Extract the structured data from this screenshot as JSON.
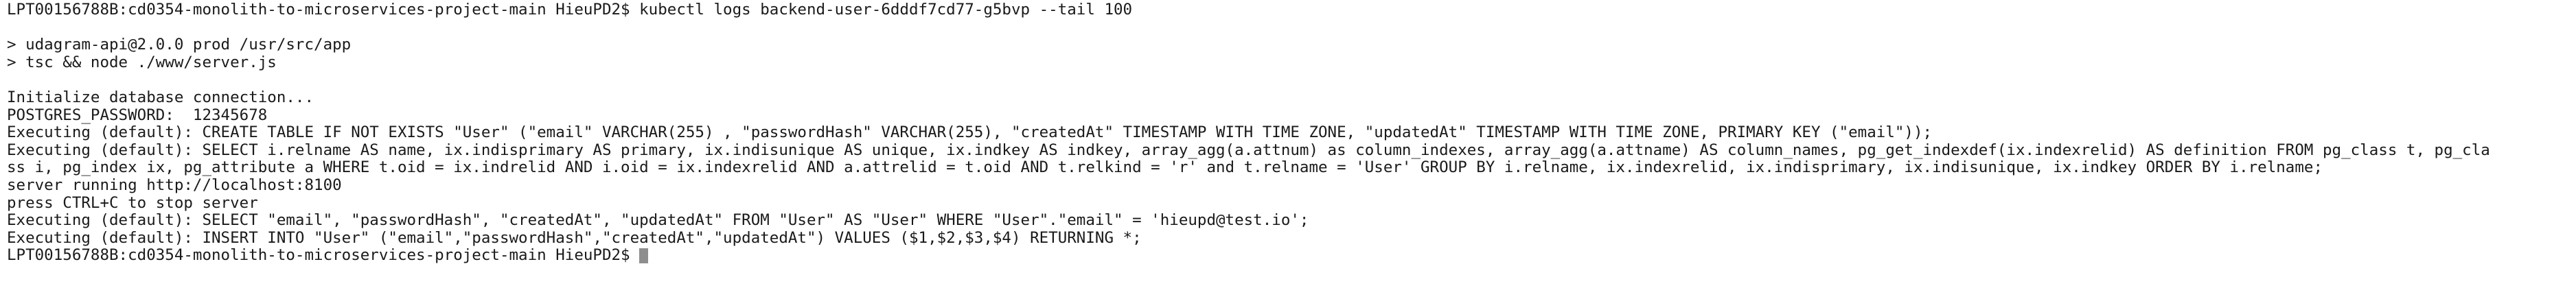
{
  "terminal": {
    "lines": [
      {
        "kind": "command",
        "text": "LPT00156788B:cd0354-monolith-to-microservices-project-main HieuPD2$ kubectl logs backend-user-6dddf7cd77-g5bvp --tail 100"
      },
      {
        "kind": "blank",
        "text": ""
      },
      {
        "kind": "output",
        "text": "> udagram-api@2.0.0 prod /usr/src/app"
      },
      {
        "kind": "output",
        "text": "> tsc && node ./www/server.js"
      },
      {
        "kind": "blank",
        "text": ""
      },
      {
        "kind": "output",
        "text": "Initialize database connection..."
      },
      {
        "kind": "output",
        "text": "POSTGRES_PASSWORD:  12345678"
      },
      {
        "kind": "output",
        "text": "Executing (default): CREATE TABLE IF NOT EXISTS \"User\" (\"email\" VARCHAR(255) , \"passwordHash\" VARCHAR(255), \"createdAt\" TIMESTAMP WITH TIME ZONE, \"updatedAt\" TIMESTAMP WITH TIME ZONE, PRIMARY KEY (\"email\"));"
      },
      {
        "kind": "output",
        "text": "Executing (default): SELECT i.relname AS name, ix.indisprimary AS primary, ix.indisunique AS unique, ix.indkey AS indkey, array_agg(a.attnum) as column_indexes, array_agg(a.attname) AS column_names, pg_get_indexdef(ix.indexrelid) AS definition FROM pg_class t, pg_cla"
      },
      {
        "kind": "output",
        "text": "ss i, pg_index ix, pg_attribute a WHERE t.oid = ix.indrelid AND i.oid = ix.indexrelid AND a.attrelid = t.oid AND t.relkind = 'r' and t.relname = 'User' GROUP BY i.relname, ix.indexrelid, ix.indisprimary, ix.indisunique, ix.indkey ORDER BY i.relname;"
      },
      {
        "kind": "output",
        "text": "server running http://localhost:8100"
      },
      {
        "kind": "output",
        "text": "press CTRL+C to stop server"
      },
      {
        "kind": "output",
        "text": "Executing (default): SELECT \"email\", \"passwordHash\", \"createdAt\", \"updatedAt\" FROM \"User\" AS \"User\" WHERE \"User\".\"email\" = 'hieupd@test.io';"
      },
      {
        "kind": "output",
        "text": "Executing (default): INSERT INTO \"User\" (\"email\",\"passwordHash\",\"createdAt\",\"updatedAt\") VALUES ($1,$2,$3,$4) RETURNING *;"
      }
    ],
    "prompt": "LPT00156788B:cd0354-monolith-to-microservices-project-main HieuPD2$ ",
    "cursor_color": "#8e8e8e",
    "background_color": "#ffffff",
    "text_color": "#1a1a1a"
  }
}
